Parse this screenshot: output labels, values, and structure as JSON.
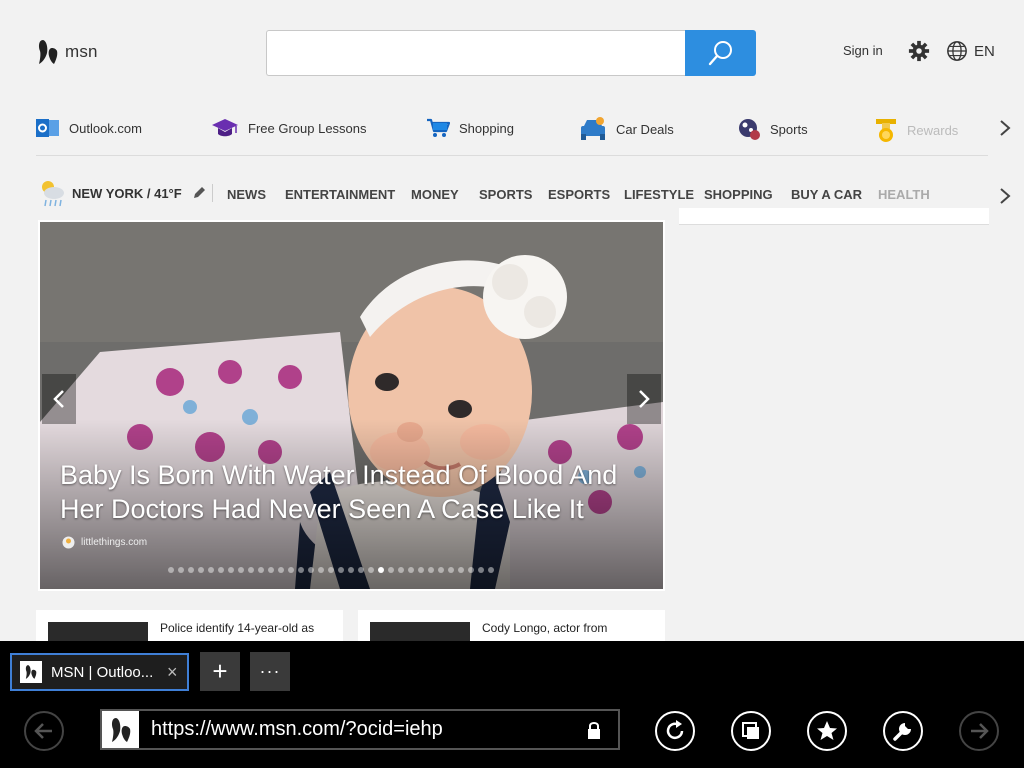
{
  "header": {
    "logo_text": "msn",
    "search_placeholder": "",
    "sign_in": "Sign in",
    "language": "EN"
  },
  "quick_links": [
    {
      "label": "Outlook.com",
      "icon": "outlook-icon"
    },
    {
      "label": "Free Group Lessons",
      "icon": "graduation-cap-icon"
    },
    {
      "label": "Shopping",
      "icon": "shopping-cart-icon"
    },
    {
      "label": "Car Deals",
      "icon": "car-icon"
    },
    {
      "label": "Sports",
      "icon": "sports-ball-icon"
    },
    {
      "label": "Rewards",
      "icon": "rewards-medal-icon"
    }
  ],
  "weather": {
    "label": "NEW YORK / 41°F"
  },
  "nav": [
    "NEWS",
    "ENTERTAINMENT",
    "MONEY",
    "SPORTS",
    "ESPORTS",
    "LIFESTYLE",
    "SHOPPING",
    "BUY A CAR",
    "HEALTH"
  ],
  "hero": {
    "headline": "Baby Is Born With Water Instead Of Blood And Her Doctors Had Never Seen A Case Like It",
    "source": "littlethings.com",
    "slide_count": 33,
    "active_slide": 21
  },
  "cards": [
    {
      "title": "Police identify 14-year-old as"
    },
    {
      "title": "Cody Longo, actor from"
    }
  ],
  "browser": {
    "tab_title": "MSN | Outloo...",
    "tab_close": "×",
    "new_tab": "+",
    "more": "···",
    "url": "https://www.msn.com/?ocid=iehp"
  },
  "colors": {
    "accent": "#2d8ee0",
    "tab_border": "#3f7fd6",
    "background": "#f2f2f2"
  }
}
